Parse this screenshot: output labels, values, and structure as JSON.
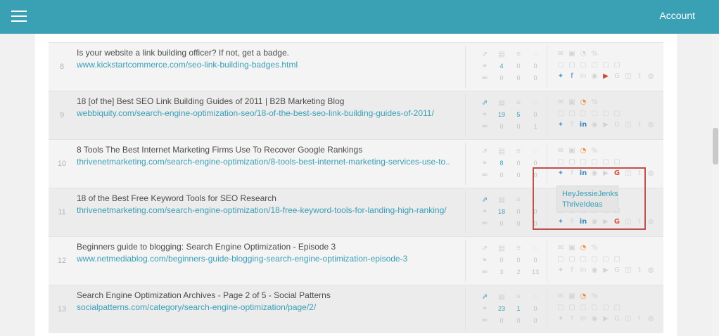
{
  "header": {
    "account_label": "Account",
    "accent_color": "#3aa0b4"
  },
  "icons": {
    "metrics_row1": [
      "external-link-icon",
      "document-icon",
      "list-icon",
      "comment-icon"
    ],
    "metrics_row2_icon": "link-icon",
    "metrics_row3_icon": "broken-link-icon",
    "social_row1": [
      "email-icon",
      "page-icon",
      "rss-icon",
      "percent-icon"
    ],
    "social_row2": [
      "doc-icon",
      "doc-icon",
      "doc-icon",
      "doc-icon",
      "doc-icon",
      "doc-icon"
    ],
    "social_row3": [
      "twitter-icon",
      "facebook-icon",
      "linkedin-icon",
      "pinterest-icon",
      "youtube-icon",
      "google-icon",
      "instagram-icon",
      "tumblr-icon",
      "github-icon"
    ]
  },
  "rows": [
    {
      "num": "8",
      "title": "Is your website a link building officer? If not, get a badge.",
      "url": "www.kickstartcommerce.com/seo-link-building-badges.html",
      "row2_values": [
        "4",
        "0",
        "0"
      ],
      "row3_values": [
        "0",
        "0",
        "0"
      ]
    },
    {
      "num": "9",
      "title": "18 [of the] Best SEO Link Building Guides of 2011 | B2B Marketing Blog",
      "url": "webbiquity.com/search-engine-optimization-seo/18-of-the-best-seo-link-building-guides-of-2011/",
      "row2_values": [
        "19",
        "5",
        "0"
      ],
      "row3_values": [
        "0",
        "0",
        "1"
      ]
    },
    {
      "num": "10",
      "title": "8 Tools The Best Internet Marketing Firms Use To Recover Google Rankings",
      "url": "thrivenetmarketing.com/search-engine-optimization/8-tools-best-internet-marketing-services-use-to..",
      "row2_values": [
        "8",
        "0",
        "0"
      ],
      "row3_values": [
        "0",
        "0",
        "0"
      ]
    },
    {
      "num": "11",
      "title": "18 of the Best Free Keyword Tools for SEO Research",
      "url": "thrivenetmarketing.com/search-engine-optimization/18-free-keyword-tools-for-landing-high-ranking/",
      "row2_values": [
        "18",
        "0",
        "0"
      ],
      "row3_values": [
        "0",
        "0",
        "0"
      ]
    },
    {
      "num": "12",
      "title": "Beginners guide to blogging: Search Engine Optimization - Episode 3",
      "url": "www.netmediablog.com/beginners-guide-blogging-search-engine-optimization-episode-3",
      "row2_values": [
        "0",
        "0",
        "0"
      ],
      "row3_values": [
        "3",
        "2",
        "13"
      ]
    },
    {
      "num": "13",
      "title": "Search Engine Optimization Archives - Page 2 of 5 - Social Patterns",
      "url": "socialpatterns.com/category/search-engine-optimization/page/2/",
      "row2_values": [
        "23",
        "1",
        "0"
      ],
      "row3_values": [
        "0",
        "0",
        "0"
      ]
    }
  ],
  "tooltip": {
    "line1": "HeyJessieJenks",
    "line2": "ThriveIdeas"
  }
}
